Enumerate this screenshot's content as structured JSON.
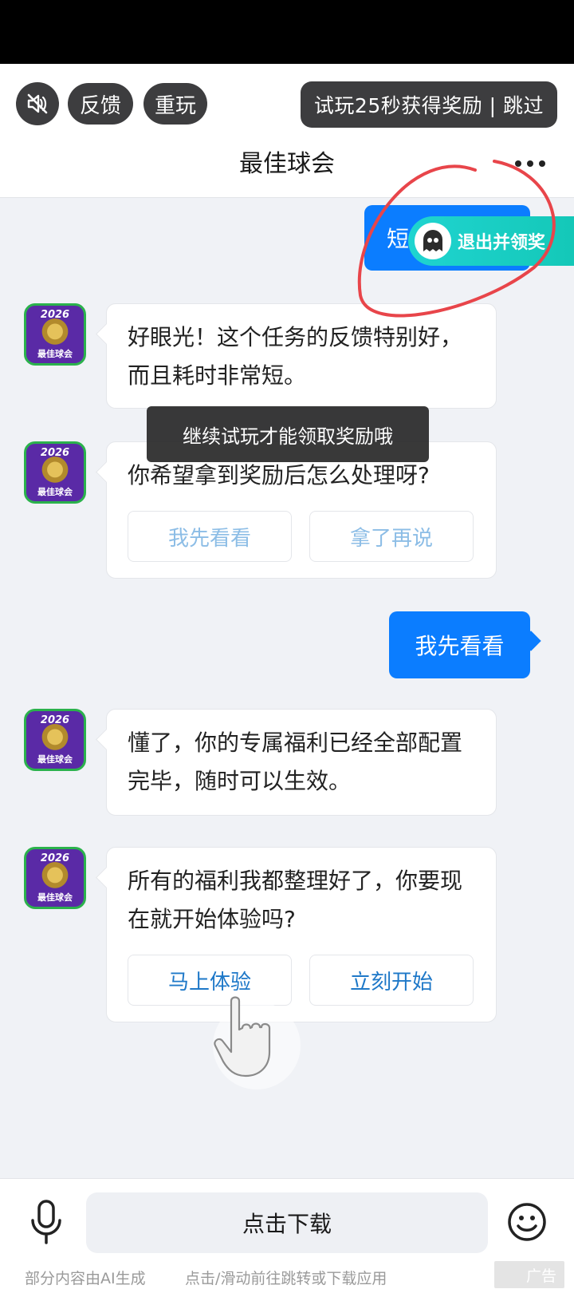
{
  "top_bar": {
    "feedback_label": "反馈",
    "replay_label": "重玩",
    "reward_text": "试玩25秒获得奖励 | 跳过"
  },
  "header": {
    "title": "最佳球会"
  },
  "avatar": {
    "year": "2026",
    "name": "最佳球会"
  },
  "overlay": {
    "exit_reward_label": "退出并领奖",
    "hidden_bubble_fragment": "短",
    "toast": "继续试玩才能领取奖励哦"
  },
  "messages": [
    {
      "text": "好眼光！这个任务的反馈特别好，而且耗时非常短。"
    },
    {
      "text": "你希望拿到奖励后怎么处理呀?",
      "choices": [
        "我先看看",
        "拿了再说"
      ]
    },
    {
      "user_reply": "我先看看"
    },
    {
      "text": "懂了，你的专属福利已经全部配置完毕，随时可以生效。"
    },
    {
      "text": "所有的福利我都整理好了，你要现在就开始体验吗?",
      "choices": [
        "马上体验",
        "立刻开始"
      ]
    }
  ],
  "bottom_bar": {
    "download_label": "点击下载",
    "ai_note": "部分内容由AI生成",
    "jump_note": "点击/滑动前往跳转或下载应用",
    "ad_label": "广告"
  },
  "colors": {
    "accent": "#0b7dff",
    "teal": "#1fd4d0",
    "dark_pill": "#3d3d3f",
    "annotation_red": "#e8454a"
  }
}
